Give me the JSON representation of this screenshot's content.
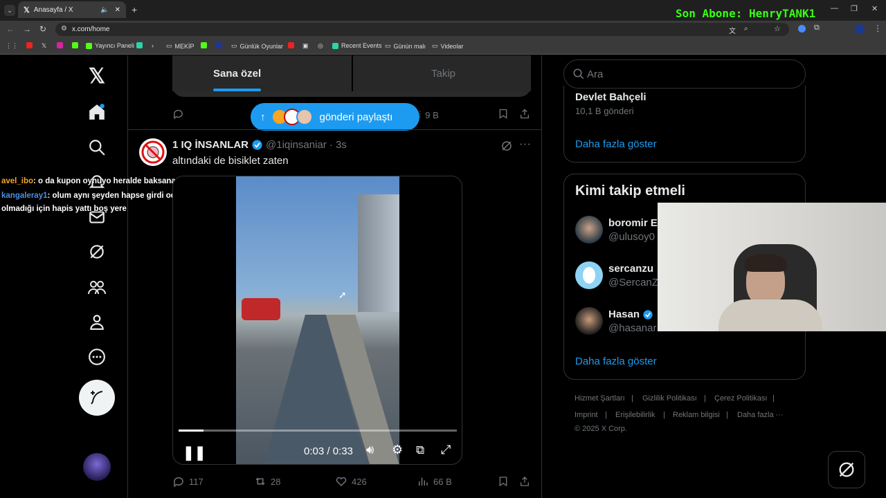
{
  "browser": {
    "tab_title": "Anasayfa / X",
    "url": "x.com/home",
    "overlay_text": "Son Abone: HenryTANK1",
    "bookmarks": [
      "Yayıncı Paneli",
      "MEKİP",
      "Günlük Oyunlar",
      "Recent Events",
      "Günün malı",
      "Videolar"
    ]
  },
  "top_tabs": {
    "for_you": "Sana özel",
    "following": "Takip"
  },
  "prev_post": {
    "views": "9 B"
  },
  "share_pill": {
    "label": "gönderi paylaştı"
  },
  "post": {
    "author": "1 IQ İNSANLAR",
    "handle": "@1iqinsaniar",
    "time": "· 3s",
    "text": "altındaki de bisiklet zaten",
    "video": {
      "time": "0:03 / 0:33",
      "progress": 0.09
    },
    "replies": "117",
    "reposts": "28",
    "likes": "426",
    "views": "66 B"
  },
  "chat": [
    {
      "user": "avel_ibo",
      "user_color": "#f5a623",
      "msg": ": o da kupon oynuyo heralde baksana takima"
    },
    {
      "user": "kangaleray1",
      "user_color": "#4a90e2",
      "msg": ": olum aynı şeyden hapse girdi oda teslim"
    },
    {
      "user": "",
      "user_color": "#ffffff",
      "msg": "olmadığı için hapis yattı boş yere"
    }
  ],
  "search": {
    "placeholder": "Ara"
  },
  "trend": {
    "name": "Devlet Bahçeli",
    "count": "10,1 B gönderi",
    "more": "Daha fazla göster"
  },
  "who_to_follow": {
    "title": "Kimi takip etmeli",
    "users": [
      {
        "name": "boromir E",
        "handle": "@ulusoy0"
      },
      {
        "name": "sercanzu",
        "handle": "@SercanZ"
      },
      {
        "name": "Hasan",
        "handle": "@hasanar"
      }
    ],
    "more": "Daha fazla göster"
  },
  "footer": {
    "links": [
      "Hizmet Şartları",
      "Gizlilik Politikası",
      "Çerez Politikası",
      "Imprint",
      "Erişilebilirlik",
      "Reklam bilgisi",
      "Daha fazla ···"
    ],
    "copyright": "© 2025 X Corp."
  },
  "colors": {
    "accent": "#1d9bf0",
    "overlay_green": "#39ff14"
  }
}
